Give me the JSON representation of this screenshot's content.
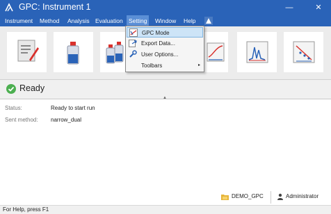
{
  "window": {
    "title": "GPC: Instrument 1",
    "minimize": "—",
    "close": "✕"
  },
  "menu": [
    {
      "label": "Instrument"
    },
    {
      "label": "Method"
    },
    {
      "label": "Analysis"
    },
    {
      "label": "Evaluation"
    },
    {
      "label": "Setting"
    },
    {
      "label": "Window"
    },
    {
      "label": "Help"
    }
  ],
  "setting_menu": {
    "items": [
      {
        "label": "GPC Mode",
        "icon": "gpc-mode-icon"
      },
      {
        "label": "Export Data...",
        "icon": "export-icon"
      },
      {
        "label": "User Options...",
        "icon": "wrench-icon"
      },
      {
        "label": "Toolbars",
        "submenu": "▸"
      }
    ]
  },
  "ready": {
    "text": "Ready"
  },
  "info": [
    {
      "label": "Status:",
      "value": "Ready to start run"
    },
    {
      "label": "Sent method:",
      "value": "narrow_dual"
    }
  ],
  "footer": {
    "project": "DEMO_GPC",
    "user": "Administrator"
  },
  "statusbar": {
    "text": "For Help, press F1"
  },
  "colors": {
    "titlebar": "#2a63b8",
    "ready_green": "#4caf50",
    "menu_highlight": "#cde4f7"
  }
}
